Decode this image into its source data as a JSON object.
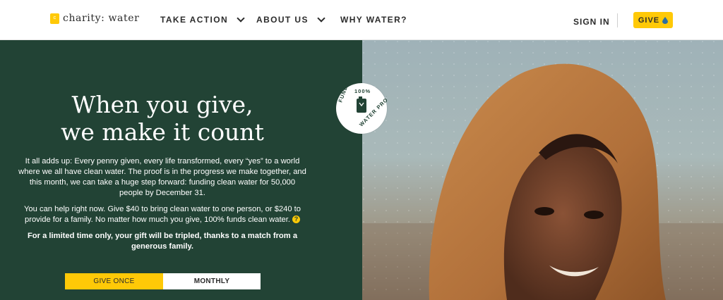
{
  "header": {
    "logo_text": "charity: water",
    "nav": [
      {
        "label": "TAKE ACTION"
      },
      {
        "label": "ABOUT US"
      },
      {
        "label": "WHY WATER?"
      }
    ],
    "sign_in": "SIGN IN",
    "give": "GIVE"
  },
  "hero": {
    "headline_line1": "When you give,",
    "headline_line2": "we make it count",
    "para1": "It all adds up: Every penny given, every life transformed, every “yes” to a world where we all have clean water. The proof is in the progress we make together, and this month, we can take a huge step forward: funding clean water for 50,000 people by December 31.",
    "para2": "You can help right now. Give $40 to bring clean water to one person, or $240 to provide for a family. No matter how much you give, 100% funds clean water.",
    "para2_help": "?",
    "para3": "For a limited time only, your gift will be tripled, thanks to a match from a generous family.",
    "give_once": "GIVE ONCE",
    "monthly": "MONTHLY"
  },
  "badge": {
    "top": "100%",
    "left": "FUNDS",
    "right": "WATER PROJECTS"
  },
  "colors": {
    "brand_yellow": "#ffc907",
    "panel_green": "#224335"
  }
}
